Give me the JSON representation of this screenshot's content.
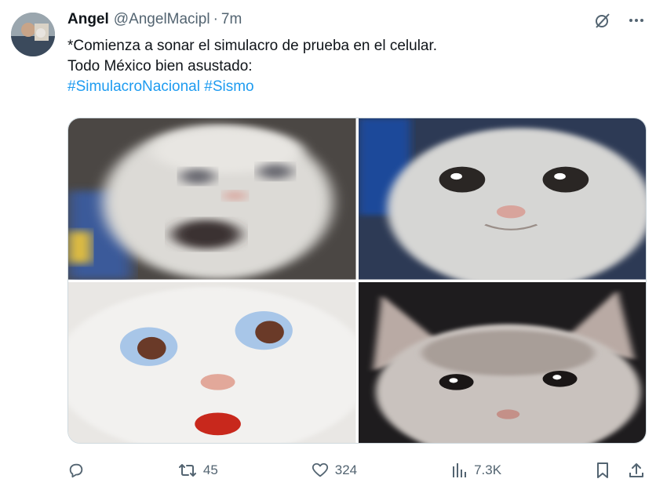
{
  "post": {
    "author_name": "Angel",
    "handle": "@AngelMacipl",
    "separator": "·",
    "time": "7m",
    "text_line1": "*Comienza a sonar el simulacro de prueba en el celular.",
    "text_line2": "Todo México bien asustado:",
    "hashtags": [
      "#SimulacroNacional",
      "#Sismo"
    ]
  },
  "actions": {
    "reply_icon": "reply-icon",
    "retweet_count": "45",
    "like_count": "324",
    "views_count": "7.3K"
  },
  "colors": {
    "text": "#0f1419",
    "secondary": "#536471",
    "link": "#1d9bf0",
    "border": "#cfd9de"
  }
}
